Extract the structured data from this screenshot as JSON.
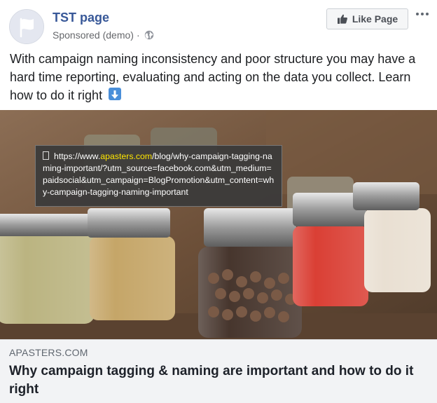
{
  "header": {
    "page_name": "TST page",
    "sponsored_label": "Sponsored (demo)",
    "dot": "·",
    "privacy_icon": "globe-icon",
    "like_button_label": "Like Page",
    "like_icon": "thumbs-up-icon",
    "more_icon": "more-options-icon"
  },
  "post": {
    "text": "With campaign naming inconsistency and poor structure you may have a hard time reporting, evaluating and acting on the data you collect. Learn how to do it right",
    "emoji_icon": "down-arrow-icon"
  },
  "tooltip": {
    "prefix": "https://www.",
    "highlight": "apasters.com",
    "rest": "/blog/why-campaign-tagging-naming-important/?utm_source=facebook.com&utm_medium=paidsocial&utm_campaign=BlogPromotion&utm_content=why-campaign-tagging-naming-important"
  },
  "link": {
    "domain": "APASTERS.COM",
    "title": "Why campaign tagging & naming are important and how to do it right"
  },
  "colors": {
    "page_name": "#385898",
    "tooltip_highlight": "#ffe600",
    "footer_bg": "#f2f3f5"
  }
}
